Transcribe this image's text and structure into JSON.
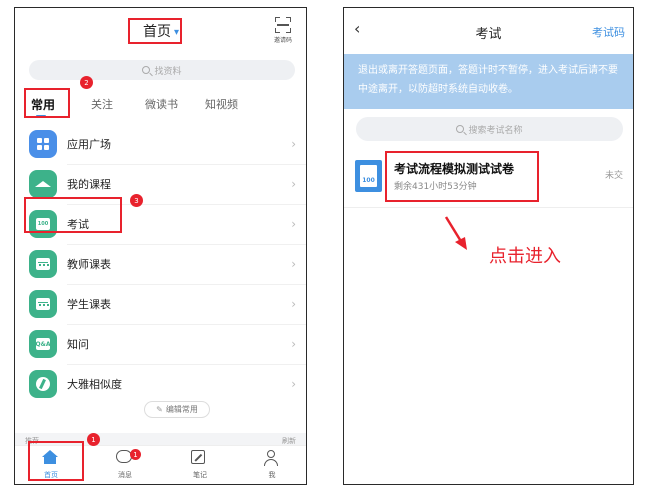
{
  "left": {
    "header": {
      "title": "首页",
      "chevron": "▾",
      "scan_label": "邀请码"
    },
    "search": {
      "placeholder": "找资料"
    },
    "tabs": [
      {
        "label": "常用",
        "active": true
      },
      {
        "label": "关注"
      },
      {
        "label": "微读书"
      },
      {
        "label": "知视频"
      }
    ],
    "list": [
      {
        "label": "应用广场",
        "icon": "grid-icon",
        "color": "#4a8fe8"
      },
      {
        "label": "我的课程",
        "icon": "graduation-cap-icon",
        "color": "#3db28a"
      },
      {
        "label": "考试",
        "icon": "exam-paper-icon",
        "color": "#3db28a",
        "glyph": "100"
      },
      {
        "label": "教师课表",
        "icon": "calendar-icon",
        "color": "#3db28a"
      },
      {
        "label": "学生课表",
        "icon": "calendar-icon",
        "color": "#3db28a"
      },
      {
        "label": "知问",
        "icon": "qa-icon",
        "color": "#3db28a",
        "glyph": "Q&A"
      },
      {
        "label": "大雅相似度",
        "icon": "leaf-icon",
        "color": "#3db28a"
      }
    ],
    "arrow": "›",
    "edit_button": "编辑常用",
    "bottom_strip": {
      "left": "推荐",
      "right": "刷新"
    },
    "tabbar": [
      {
        "label": "首页",
        "icon": "home-icon",
        "active": true
      },
      {
        "label": "消息",
        "icon": "message-icon",
        "badge": "1"
      },
      {
        "label": "笔记",
        "icon": "note-icon"
      },
      {
        "label": "我",
        "icon": "user-icon"
      }
    ],
    "step_badges": [
      "1",
      "2",
      "3"
    ]
  },
  "right": {
    "header": {
      "back": "‹",
      "title": "考试",
      "action": "考试码"
    },
    "notice": "退出或离开答题页面，答题计时不暂停，进入考试后请不要中途离开，以防超时系统自动收卷。",
    "search": {
      "placeholder": "搜索考试名称"
    },
    "exam": {
      "title": "考试流程模拟测试试卷",
      "remaining": "剩余431小时53分钟",
      "status": "未交",
      "icon_glyph": "100"
    },
    "hint": "点击进入"
  },
  "colors": {
    "accent": "#3d8fe0",
    "annotation": "#e8222d",
    "notice_bg": "#a9ccee",
    "icon_green": "#3db28a"
  }
}
